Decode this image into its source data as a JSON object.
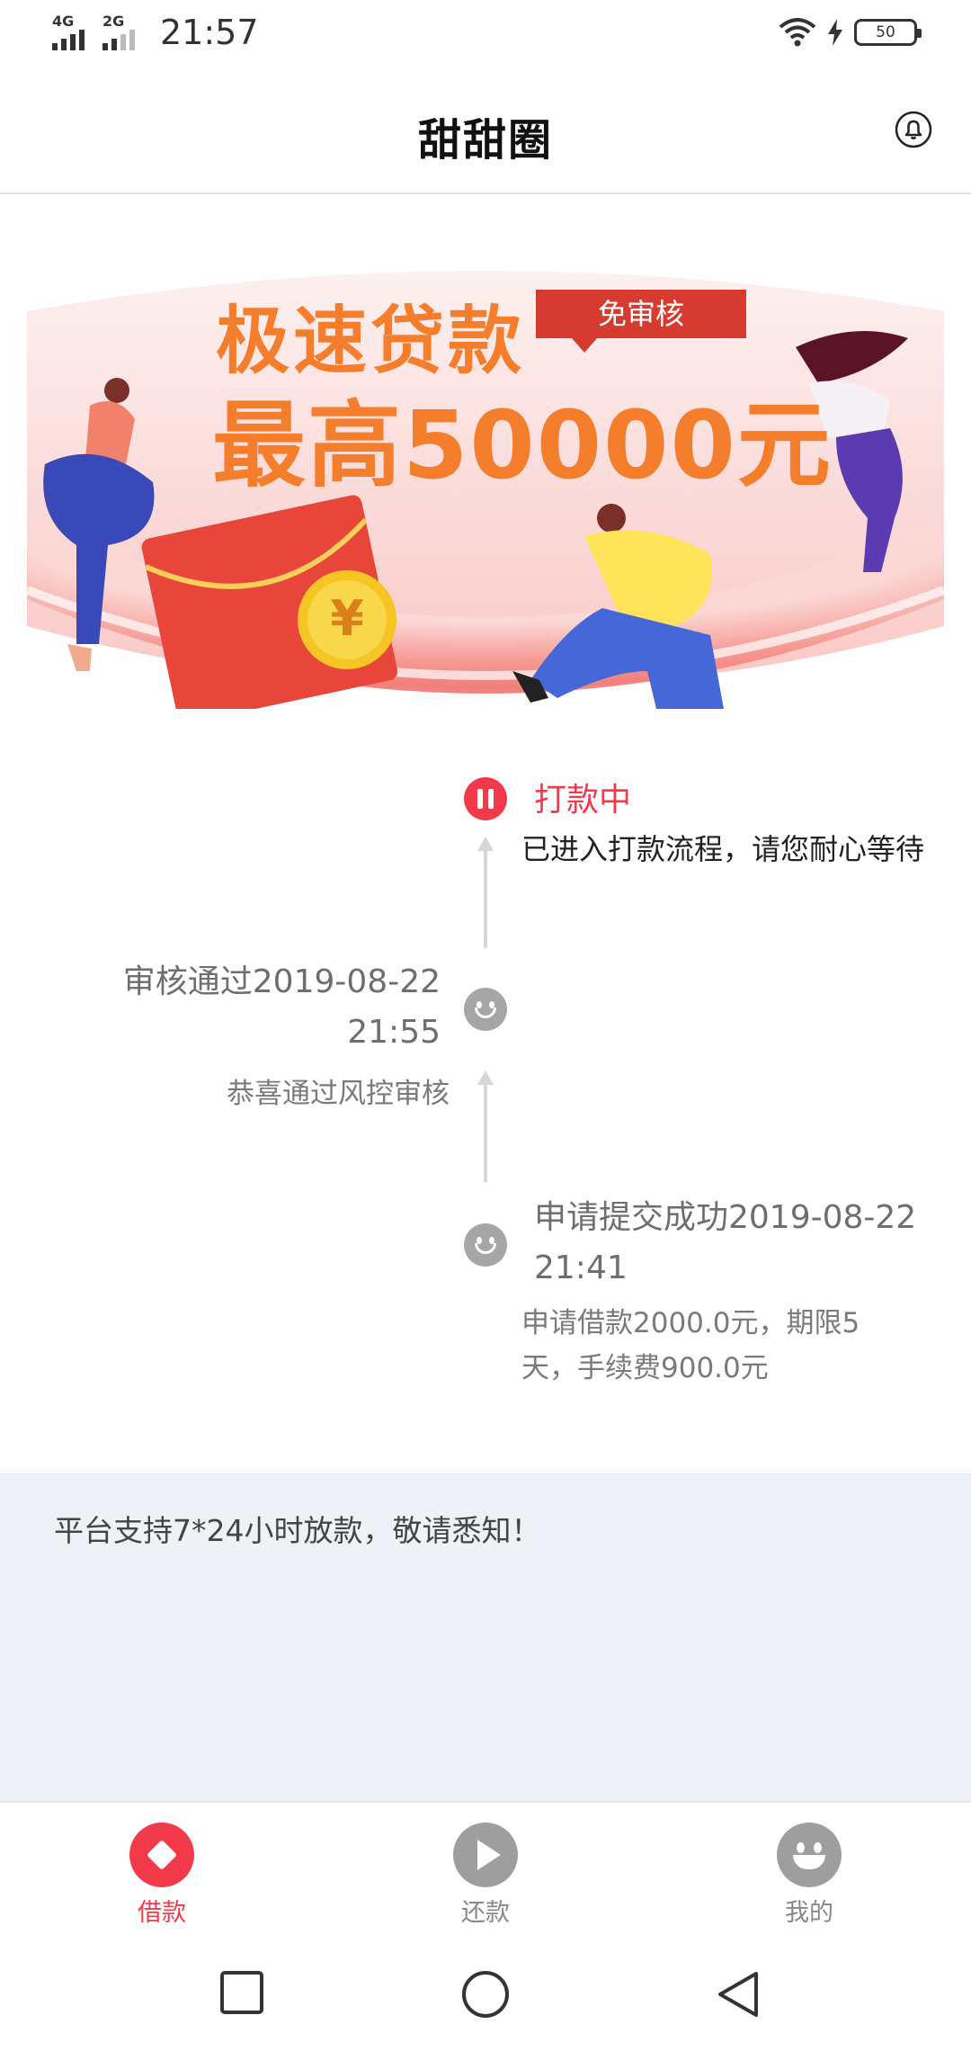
{
  "status_bar": {
    "signal1": "4G",
    "signal2": "2G",
    "time": "21:57",
    "battery": "50",
    "icons": [
      "signal-icon",
      "wifi-icon",
      "charging-icon",
      "battery-icon"
    ]
  },
  "header": {
    "title": "甜甜圈",
    "bell_icon": "bell-icon"
  },
  "banner": {
    "line1": "极速贷款",
    "line2": "最高50000元",
    "tag": "免审核",
    "coin_symbol": "¥"
  },
  "timeline": [
    {
      "title": "打款中",
      "desc": "已进入打款流程，请您耐心等待",
      "icon": "pause-icon",
      "color": "#f23a4b"
    },
    {
      "title": "审核通过2019-08-22 21:55",
      "desc": "恭喜通过风控审核",
      "icon": "smile-icon"
    },
    {
      "title": "申请提交成功2019-08-22 21:41",
      "desc": "申请借款2000.0元，期限5天，手续费900.0元",
      "icon": "smile-icon"
    }
  ],
  "notice": {
    "text": "平台支持7*24小时放款，敬请悉知！"
  },
  "bottom_nav": [
    {
      "label": "借款",
      "icon": "loan-icon",
      "active": true
    },
    {
      "label": "还款",
      "icon": "play-icon",
      "active": false
    },
    {
      "label": "我的",
      "icon": "profile-icon",
      "active": false
    }
  ],
  "colors": {
    "accent": "#f23a4b",
    "banner_text": "#f47e2c",
    "notice_bg": "#eef1f5"
  }
}
